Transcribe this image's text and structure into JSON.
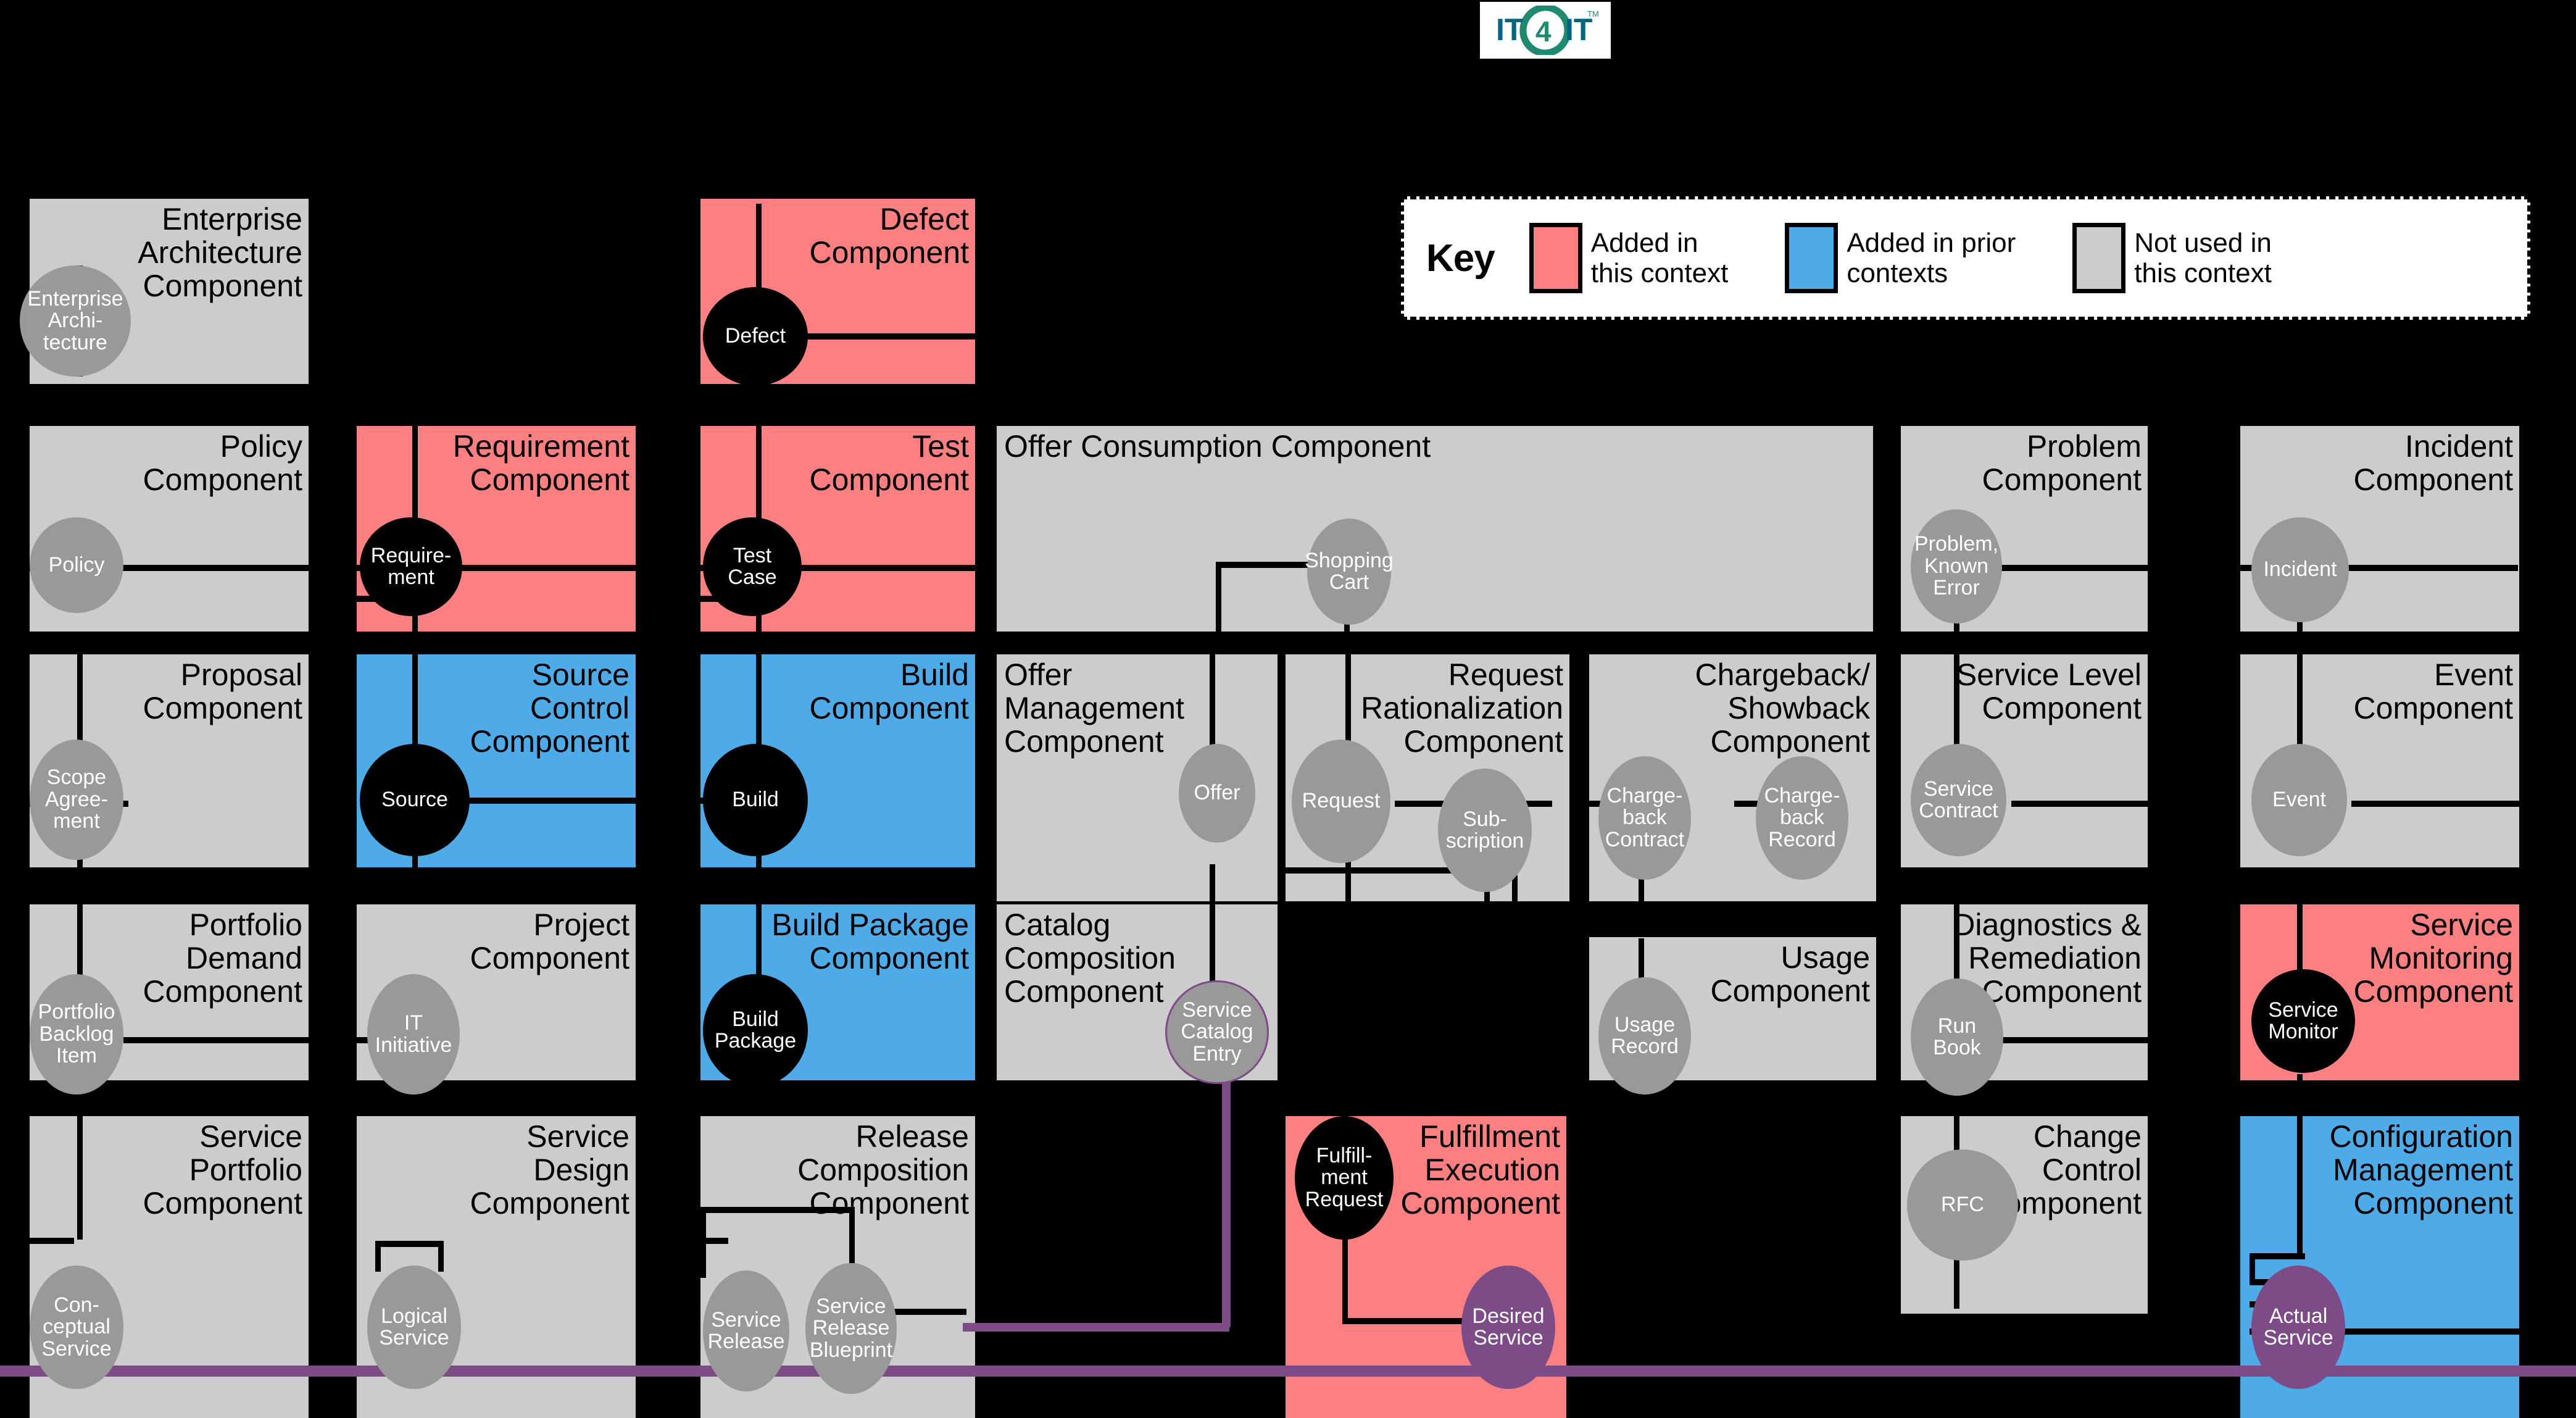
{
  "logo": {
    "alt": "IT4IT",
    "text_left": "IT",
    "text_num": "4",
    "text_right": "IT",
    "tm": "TM",
    "color_text": "#00657f",
    "color_ring": "#1f8a70"
  },
  "key": {
    "title": "Key",
    "items": [
      {
        "label": "Added in\nthis context",
        "color": "#fc8082"
      },
      {
        "label": "Added in prior\ncontexts",
        "color": "#4fabe8"
      },
      {
        "label": "Not used in\nthis context",
        "color": "#cccccc"
      }
    ]
  },
  "colors": {
    "added_this_context": "#fc8082",
    "added_prior_contexts": "#4fabe8",
    "not_used": "#cccccc",
    "node_grey": "#999999",
    "node_black": "#000000",
    "node_purple": "#7d4b86",
    "background": "#000000",
    "service_backbone": "#7d4b86"
  },
  "components": [
    {
      "id": "enterprise-architecture",
      "title": "Enterprise\nArchitecture\nComponent",
      "state": "not_used",
      "nodes": [
        {
          "label": "Enterprise\nArchi-\ntecture",
          "style": "grey"
        }
      ]
    },
    {
      "id": "defect",
      "title": "Defect\nComponent",
      "state": "added_this_context",
      "nodes": [
        {
          "label": "Defect",
          "style": "black"
        }
      ]
    },
    {
      "id": "policy",
      "title": "Policy\nComponent",
      "state": "not_used",
      "nodes": [
        {
          "label": "Policy",
          "style": "grey"
        }
      ]
    },
    {
      "id": "requirement",
      "title": "Requirement\nComponent",
      "state": "added_this_context",
      "nodes": [
        {
          "label": "Require-\nment",
          "style": "black"
        }
      ]
    },
    {
      "id": "test",
      "title": "Test\nComponent",
      "state": "added_this_context",
      "nodes": [
        {
          "label": "Test\nCase",
          "style": "black"
        }
      ]
    },
    {
      "id": "offer-consumption",
      "title": "Offer Consumption Component",
      "state": "not_used",
      "title_align": "left",
      "nodes": [
        {
          "label": "Shopping\nCart",
          "style": "grey"
        }
      ]
    },
    {
      "id": "problem",
      "title": "Problem\nComponent",
      "state": "not_used",
      "nodes": [
        {
          "label": "Problem,\nKnown\nError",
          "style": "grey"
        }
      ]
    },
    {
      "id": "incident",
      "title": "Incident\nComponent",
      "state": "not_used",
      "nodes": [
        {
          "label": "Incident",
          "style": "grey"
        }
      ]
    },
    {
      "id": "proposal",
      "title": "Proposal\nComponent",
      "state": "not_used",
      "nodes": [
        {
          "label": "Scope\nAgree-\nment",
          "style": "grey"
        }
      ]
    },
    {
      "id": "source-control",
      "title": "Source\nControl\nComponent",
      "state": "added_prior_contexts",
      "nodes": [
        {
          "label": "Source",
          "style": "black"
        }
      ]
    },
    {
      "id": "build",
      "title": "Build\nComponent",
      "state": "added_prior_contexts",
      "nodes": [
        {
          "label": "Build",
          "style": "black"
        }
      ]
    },
    {
      "id": "offer-management",
      "title": "Offer\nManagement\nComponent",
      "state": "not_used",
      "title_align": "left",
      "nodes": [
        {
          "label": "Offer",
          "style": "grey"
        }
      ]
    },
    {
      "id": "request-rationalization",
      "title": "Request\nRationalization\nComponent",
      "state": "not_used",
      "nodes": [
        {
          "label": "Request",
          "style": "grey"
        },
        {
          "label": "Sub-\nscription",
          "style": "grey"
        }
      ]
    },
    {
      "id": "chargeback-showback",
      "title": "Chargeback/\nShowback\nComponent",
      "state": "not_used",
      "nodes": [
        {
          "label": "Charge-\nback\nContract",
          "style": "grey"
        },
        {
          "label": "Charge-\nback\nRecord",
          "style": "grey"
        }
      ]
    },
    {
      "id": "service-level",
      "title": "Service Level\nComponent",
      "state": "not_used",
      "nodes": [
        {
          "label": "Service\nContract",
          "style": "grey"
        }
      ]
    },
    {
      "id": "event",
      "title": "Event\nComponent",
      "state": "not_used",
      "nodes": [
        {
          "label": "Event",
          "style": "grey"
        }
      ]
    },
    {
      "id": "portfolio-demand",
      "title": "Portfolio\nDemand\nComponent",
      "state": "not_used",
      "nodes": [
        {
          "label": "Portfolio\nBacklog\nItem",
          "style": "grey"
        }
      ]
    },
    {
      "id": "project",
      "title": "Project\nComponent",
      "state": "not_used",
      "nodes": [
        {
          "label": "IT\nInitiative",
          "style": "grey"
        }
      ]
    },
    {
      "id": "build-package",
      "title": "Build Package\nComponent",
      "state": "added_prior_contexts",
      "nodes": [
        {
          "label": "Build\nPackage",
          "style": "black"
        }
      ]
    },
    {
      "id": "catalog-composition",
      "title": "Catalog\nComposition\nComponent",
      "state": "not_used",
      "title_align": "left",
      "nodes": [
        {
          "label": "Service\nCatalog\nEntry",
          "style": "grey-purple-border"
        }
      ]
    },
    {
      "id": "usage",
      "title": "Usage\nComponent",
      "state": "not_used",
      "nodes": [
        {
          "label": "Usage\nRecord",
          "style": "grey"
        }
      ]
    },
    {
      "id": "diagnostics-remediation",
      "title": "Diagnostics &\nRemediation\nComponent",
      "state": "not_used",
      "nodes": [
        {
          "label": "Run\nBook",
          "style": "grey"
        }
      ]
    },
    {
      "id": "service-monitoring",
      "title": "Service\nMonitoring\nComponent",
      "state": "added_this_context",
      "nodes": [
        {
          "label": "Service\nMonitor",
          "style": "black"
        }
      ]
    },
    {
      "id": "service-portfolio",
      "title": "Service\nPortfolio\nComponent",
      "state": "not_used",
      "nodes": [
        {
          "label": "Con-\nceptual\nService",
          "style": "grey"
        }
      ]
    },
    {
      "id": "service-design",
      "title": "Service\nDesign\nComponent",
      "state": "not_used",
      "nodes": [
        {
          "label": "Logical\nService",
          "style": "grey"
        }
      ]
    },
    {
      "id": "release-composition",
      "title": "Release\nComposition\nComponent",
      "state": "not_used",
      "nodes": [
        {
          "label": "Service\nRelease",
          "style": "grey"
        },
        {
          "label": "Service\nRelease\nBlueprint",
          "style": "grey"
        }
      ]
    },
    {
      "id": "fulfillment-execution",
      "title": "Fulfillment\nExecution\nComponent",
      "state": "added_this_context",
      "nodes": [
        {
          "label": "Fulfill-\nment\nRequest",
          "style": "black"
        },
        {
          "label": "Desired\nService",
          "style": "purple"
        }
      ]
    },
    {
      "id": "change-control",
      "title": "Change\nControl\nComponent",
      "state": "not_used",
      "nodes": [
        {
          "label": "RFC",
          "style": "grey"
        }
      ]
    },
    {
      "id": "configuration-management",
      "title": "Configuration\nManagement\nComponent",
      "state": "added_prior_contexts",
      "nodes": [
        {
          "label": "Actual\nService",
          "style": "purple"
        }
      ]
    }
  ]
}
